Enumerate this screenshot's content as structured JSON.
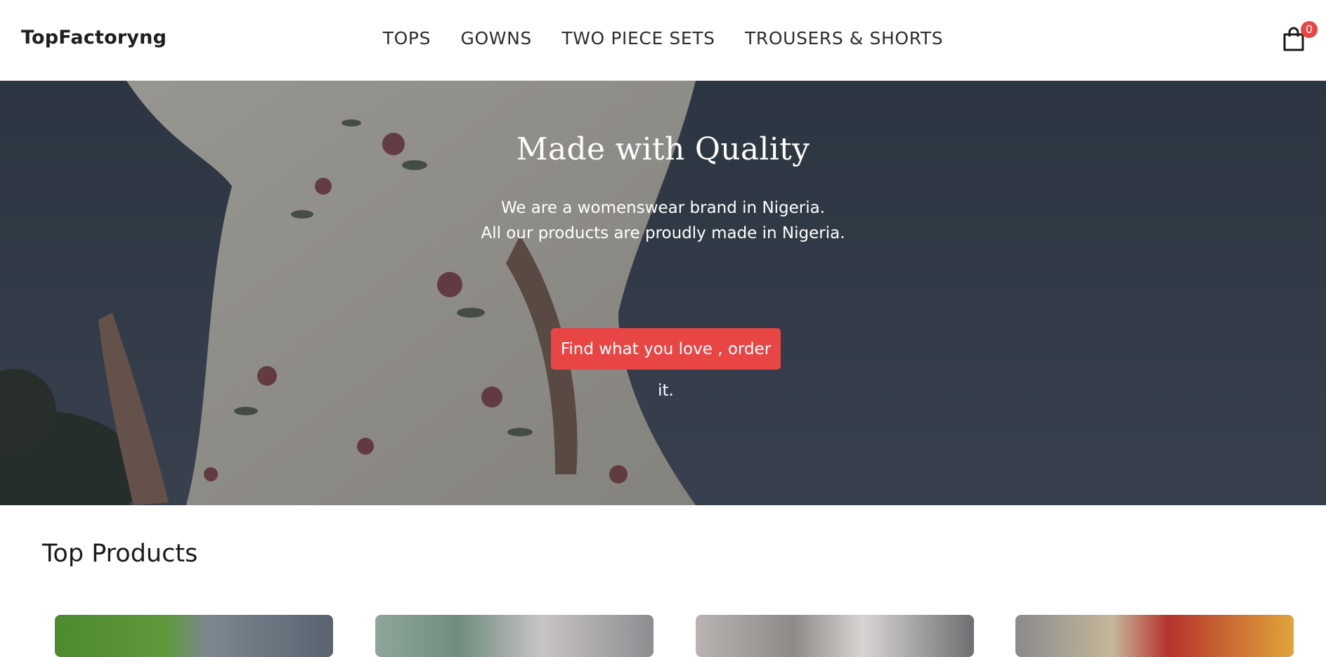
{
  "header": {
    "logo": "TopFactoryng",
    "nav": [
      "TOPS",
      "GOWNS",
      "TWO PIECE SETS",
      "TROUSERS & SHORTS"
    ],
    "cart_count": "0"
  },
  "hero": {
    "title": "Made with Quality",
    "subtitle_line1": "We are a womenswear brand in Nigeria.",
    "subtitle_line2": "All our products are proudly made in Nigeria.",
    "cta": "Find what you love , order it."
  },
  "products": {
    "section_title": "Top Products"
  },
  "colors": {
    "accent": "#e84545"
  }
}
